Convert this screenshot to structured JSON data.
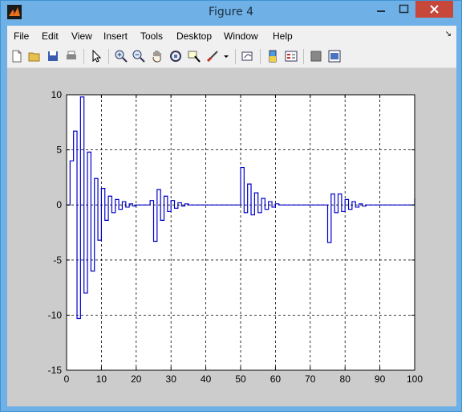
{
  "window": {
    "title": "Figure 4"
  },
  "menu": [
    "File",
    "Edit",
    "View",
    "Insert",
    "Tools",
    "Desktop",
    "Window",
    "Help"
  ],
  "toolbar": [
    "new-figure-icon",
    "open-file-icon",
    "save-icon",
    "print-icon",
    "pointer-icon",
    "zoom-in-icon",
    "zoom-out-icon",
    "pan-hand-icon",
    "rotate-3d-icon",
    "data-cursor-icon",
    "brush-icon",
    "brush-dropdown-icon",
    "link-plot-icon",
    "colorbar-icon",
    "legend-icon",
    "hide-plot-tools-icon",
    "show-plot-tools-icon"
  ],
  "colors": {
    "line": "#0000cc",
    "figure_bg": "#cccccc",
    "titlebar": "#6fb1e6",
    "close": "#c7473a"
  },
  "chart_data": {
    "type": "line",
    "title": "",
    "xlabel": "",
    "ylabel": "",
    "xlim": [
      0,
      100
    ],
    "ylim": [
      -15,
      10
    ],
    "xticks": [
      0,
      10,
      20,
      30,
      40,
      50,
      60,
      70,
      80,
      90,
      100
    ],
    "yticks": [
      10,
      5,
      0,
      -5,
      -10,
      -15
    ],
    "grid": true,
    "series": [
      {
        "style": "stairs",
        "x": [
          0,
          1,
          2,
          3,
          4,
          5,
          6,
          7,
          8,
          9,
          10,
          11,
          12,
          13,
          14,
          15,
          16,
          17,
          18,
          19,
          20,
          21,
          22,
          23,
          24,
          25,
          26,
          27,
          28,
          29,
          30,
          31,
          32,
          33,
          34,
          35,
          36,
          37,
          38,
          39,
          40,
          41,
          42,
          43,
          44,
          45,
          46,
          47,
          48,
          49,
          50,
          51,
          52,
          53,
          54,
          55,
          56,
          57,
          58,
          59,
          60,
          61,
          62,
          63,
          64,
          65,
          66,
          67,
          68,
          69,
          70,
          71,
          72,
          73,
          74,
          75,
          76,
          77,
          78,
          79,
          80,
          81,
          82,
          83,
          84,
          85,
          86,
          87,
          88,
          89,
          90,
          91,
          92,
          93,
          94,
          95,
          96,
          97,
          98,
          99,
          100
        ],
        "y": [
          0,
          4,
          6.7,
          -10.3,
          9.8,
          -8,
          4.8,
          -6,
          2.4,
          -3.2,
          1.5,
          -1.4,
          0.8,
          -0.7,
          0.5,
          -0.4,
          0.3,
          -0.2,
          0.1,
          -0.1,
          0,
          0,
          0,
          0,
          0.4,
          -3.3,
          1.4,
          -1.4,
          0.8,
          -0.6,
          0.4,
          -0.3,
          0.2,
          -0.1,
          0.1,
          0,
          0,
          0,
          0,
          0,
          0,
          0,
          0,
          0,
          0,
          0,
          0,
          0,
          0,
          0,
          3.4,
          -0.7,
          1.9,
          -0.9,
          1.1,
          -0.7,
          0.6,
          -0.4,
          0.3,
          -0.2,
          0.1,
          0,
          0,
          0,
          0,
          0,
          0,
          0,
          0,
          0,
          0,
          0,
          0,
          0,
          0,
          -3.4,
          1.0,
          -0.7,
          1.0,
          -0.6,
          0.5,
          -0.4,
          0.3,
          -0.2,
          0.1,
          -0.1,
          0,
          0,
          0,
          0,
          0,
          0,
          0,
          0,
          0,
          0,
          0,
          0,
          0,
          0,
          0.6
        ]
      }
    ]
  }
}
